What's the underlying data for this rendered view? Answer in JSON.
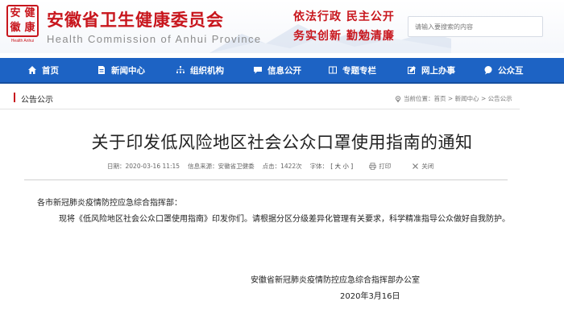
{
  "header": {
    "logo_chars": [
      "安",
      "健",
      "徽",
      "康"
    ],
    "logo_caption": "Health Anhui",
    "title": "安徽省卫生健康委员会",
    "subtitle": "Health Commission of Anhui Province",
    "slogan_line1": "依法行政 民主公开",
    "slogan_line2": "务实创新 勤勉清廉",
    "search_placeholder": "请输入要搜索的内容"
  },
  "nav": {
    "items": [
      {
        "label": "首页",
        "icon": "home-icon"
      },
      {
        "label": "新闻中心",
        "icon": "document-icon"
      },
      {
        "label": "组织机构",
        "icon": "organization-icon"
      },
      {
        "label": "信息公开",
        "icon": "chat-icon"
      },
      {
        "label": "专题专栏",
        "icon": "columns-icon"
      },
      {
        "label": "网上办事",
        "icon": "edit-icon"
      },
      {
        "label": "公众互",
        "icon": "speech-icon"
      }
    ]
  },
  "breadcrumb": {
    "section": "公告公示",
    "location_label": "当前位置：",
    "path": [
      "首页",
      "新闻中心",
      "公告公示"
    ]
  },
  "article": {
    "title": "关于印发低风险地区社会公众口罩使用指南的通知",
    "meta": {
      "date": "日期：2020-03-16 11:15",
      "source": "信息来源：安徽省卫健委",
      "clicks": "点击：1422次",
      "font_label": "字体：",
      "font_size": "[ 大 小 ]",
      "print": "打印",
      "close": "关闭"
    },
    "salutation": "各市新冠肺炎疫情防控应急综合指挥部：",
    "body": "现将《低风险地区社会公众口罩使用指南》印发你们。请根据分区分级差异化管理有关要求，科学精准指导公众做好自我防护。",
    "signature_org": "安徽省新冠肺炎疫情防控应急综合指挥部办公室",
    "signature_date": "2020年3月16日"
  },
  "colors": {
    "brand_red": "#c8161d",
    "nav_blue": "#1d63c4"
  }
}
